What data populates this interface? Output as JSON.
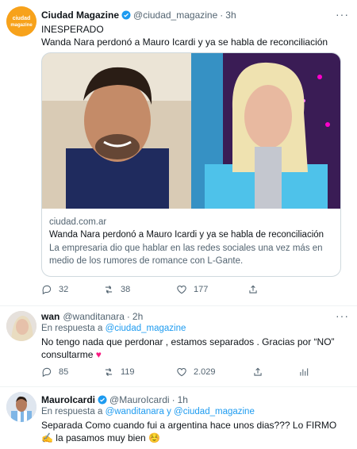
{
  "tweets": [
    {
      "name": "Ciudad Magazine",
      "handle": "@ciudad_magazine",
      "time": "3h",
      "text_line1": "INESPERADO",
      "text_line2": "Wanda Nara perdonó a Mauro Icardi y ya se habla de reconciliación",
      "card": {
        "domain": "ciudad.com.ar",
        "title": "Wanda Nara perdonó a Mauro Icardi y ya se habla de reconciliación",
        "description": "La empresaria dio que hablar en las redes sociales una vez más en medio de los rumores de romance con L-Gante."
      },
      "counts": {
        "replies": "32",
        "retweets": "38",
        "likes": "177"
      },
      "avatar_logo": "ciudad magazine"
    },
    {
      "name": "wan",
      "handle": "@wanditanara",
      "time": "2h",
      "reply_prefix": "En respuesta a",
      "reply_to": "@ciudad_magazine",
      "text": "No tengo nada que perdonar , estamos separados . Gracias por “NO” consultarme",
      "counts": {
        "replies": "85",
        "retweets": "119",
        "likes": "2.029"
      }
    },
    {
      "name": "MauroIcardi",
      "handle": "@MauroIcardi",
      "time": "1h",
      "reply_prefix": "En respuesta a",
      "reply_to": "@wanditanara y @ciudad_magazine",
      "text": "Separada Como cuando fui a argentina hace unos dias??? Lo FIRMO ✍️ la pasamos muy bien ☺️"
    }
  ],
  "colors": {
    "link": "#1d9bf0",
    "verified": "#1d9bf0",
    "like_active": "#f91880",
    "muted": "#536471"
  }
}
